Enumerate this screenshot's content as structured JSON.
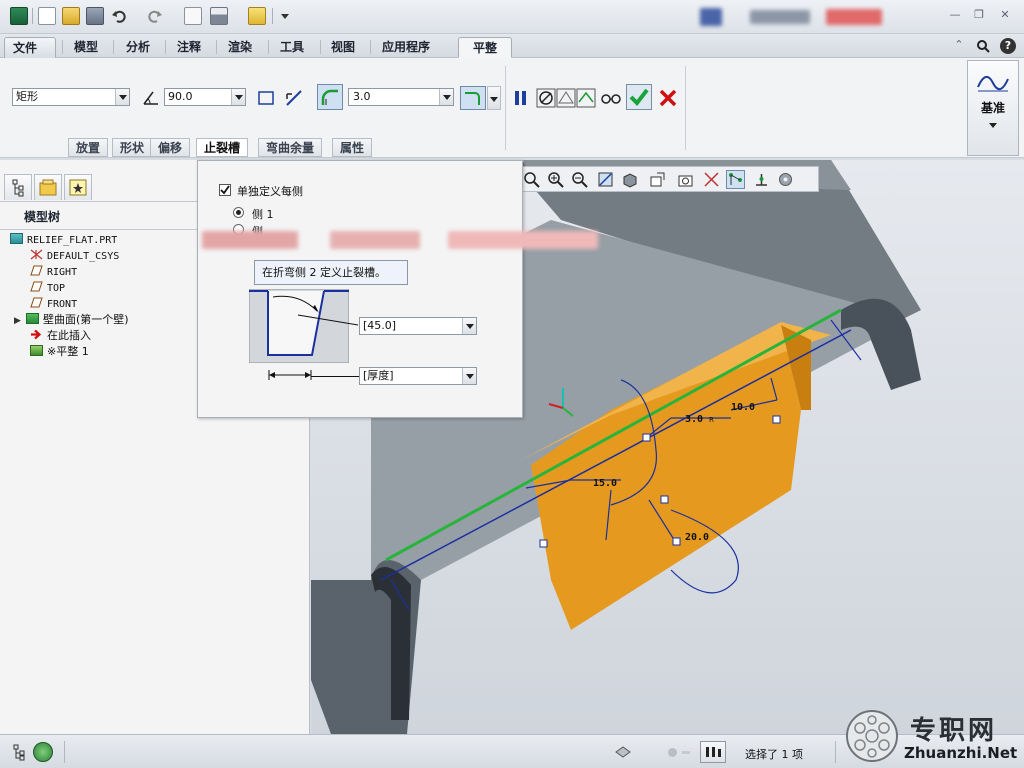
{
  "app": {
    "quick_access_icons": [
      "app-logo-icon",
      "new-file-icon",
      "open-file-icon",
      "save-icon",
      "undo-icon",
      "redo-icon",
      "regenerate-icon",
      "window-icon",
      "folder-icon",
      "customize-icon"
    ]
  },
  "ribbon_tabs": [
    {
      "label": "文件",
      "type": "file"
    },
    {
      "label": "模型"
    },
    {
      "label": "分析"
    },
    {
      "label": "注释"
    },
    {
      "label": "渲染"
    },
    {
      "label": "工具"
    },
    {
      "label": "视图"
    },
    {
      "label": "应用程序"
    },
    {
      "label": "平整",
      "active": true
    }
  ],
  "ribbon": {
    "shape_select": "矩形",
    "angle_value": "90.0",
    "radius_value": "3.0",
    "datum_label": "基准",
    "subtabs": [
      {
        "label": "放置"
      },
      {
        "label": "形状"
      },
      {
        "label": "偏移"
      },
      {
        "label": "止裂槽",
        "active": true
      },
      {
        "label": "弯曲余量"
      },
      {
        "label": "属性"
      }
    ]
  },
  "model_tree": {
    "title": "模型树",
    "items": [
      {
        "label": "RELIEF_FLAT.PRT",
        "icon": "part-icon",
        "level": 0
      },
      {
        "label": "DEFAULT_CSYS",
        "icon": "csys-icon",
        "level": 1
      },
      {
        "label": "RIGHT",
        "icon": "datum-plane-icon",
        "level": 1
      },
      {
        "label": "TOP",
        "icon": "datum-plane-icon",
        "level": 1
      },
      {
        "label": "FRONT",
        "icon": "datum-plane-icon",
        "level": 1
      },
      {
        "label": "壁曲面(第一个壁)",
        "icon": "wall-icon",
        "level": 1,
        "expandable": true
      },
      {
        "label": "在此插入",
        "icon": "insert-here-icon",
        "level": 1
      },
      {
        "label": "※平整 1",
        "icon": "flat-wall-icon",
        "level": 1
      }
    ]
  },
  "relief_dialog": {
    "define_each_side_label": "单独定义每侧",
    "define_each_side_checked": true,
    "side1_label": "侧 1",
    "side2_label": "侧",
    "tooltip": "在折弯侧 2 定义止裂槽。",
    "angle_value": "[45.0]",
    "depth_value": "[厚度]"
  },
  "model_dims": {
    "dim_radius": "3.0",
    "dim_radius_unit": "R",
    "dim_width": "10.0",
    "dim_length": "15.0",
    "dim_offset": "20.0"
  },
  "status": {
    "selection_text": "选择了 1 项"
  },
  "watermark": {
    "brand": "专职网",
    "site": "Zhuanzhi.Net"
  },
  "colors": {
    "ribbon_bg": "#f2f3f5",
    "accept_green": "#1aa33a",
    "cancel_red": "#d01010",
    "model_gray": "#6b737a",
    "wall_orange": "#e59a1f",
    "edge_green": "#28b43c",
    "dim_blue": "#1a2fa0"
  }
}
